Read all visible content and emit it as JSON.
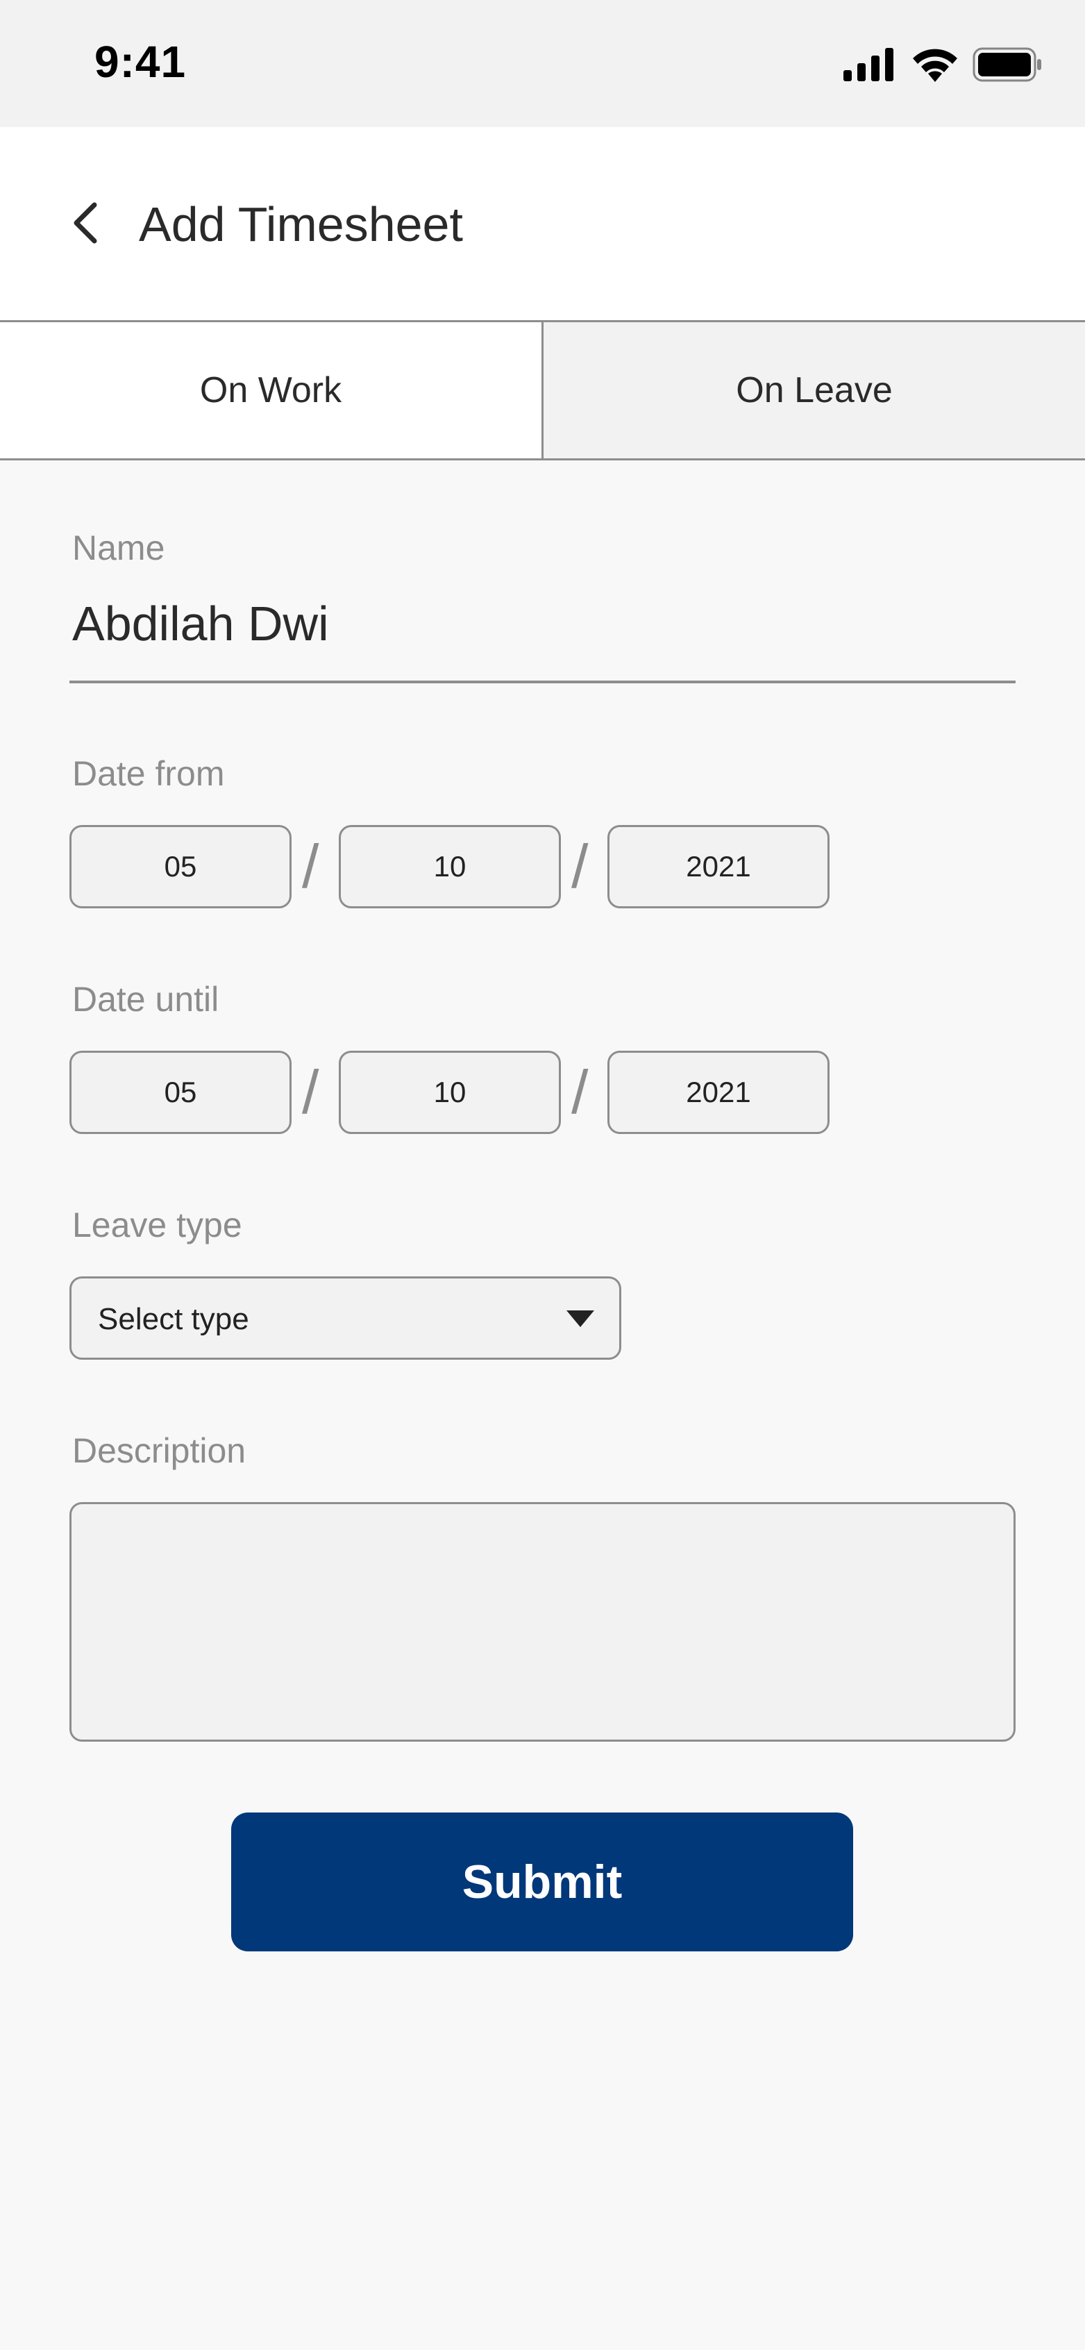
{
  "status_bar": {
    "time": "9:41",
    "icons": [
      "signal-icon",
      "wifi-icon",
      "battery-icon"
    ]
  },
  "header": {
    "back_icon": "chevron-left-icon",
    "title": "Add Timesheet"
  },
  "tabs": [
    {
      "label": "On Work",
      "active": true
    },
    {
      "label": "On Leave",
      "active": false
    }
  ],
  "form": {
    "name": {
      "label": "Name",
      "value": "Abdilah Dwi"
    },
    "date_from": {
      "label": "Date from",
      "day": "05",
      "month": "10",
      "year": "2021",
      "separator": "/"
    },
    "date_until": {
      "label": "Date until",
      "day": "05",
      "month": "10",
      "year": "2021",
      "separator": "/"
    },
    "leave_type": {
      "label": "Leave type",
      "placeholder": "Select type"
    },
    "description": {
      "label": "Description",
      "value": ""
    },
    "submit_label": "Submit"
  },
  "colors": {
    "primary": "#01387a",
    "label": "#8c8c8c",
    "border": "#8d8d8d",
    "field_bg": "#f2f2f2"
  }
}
